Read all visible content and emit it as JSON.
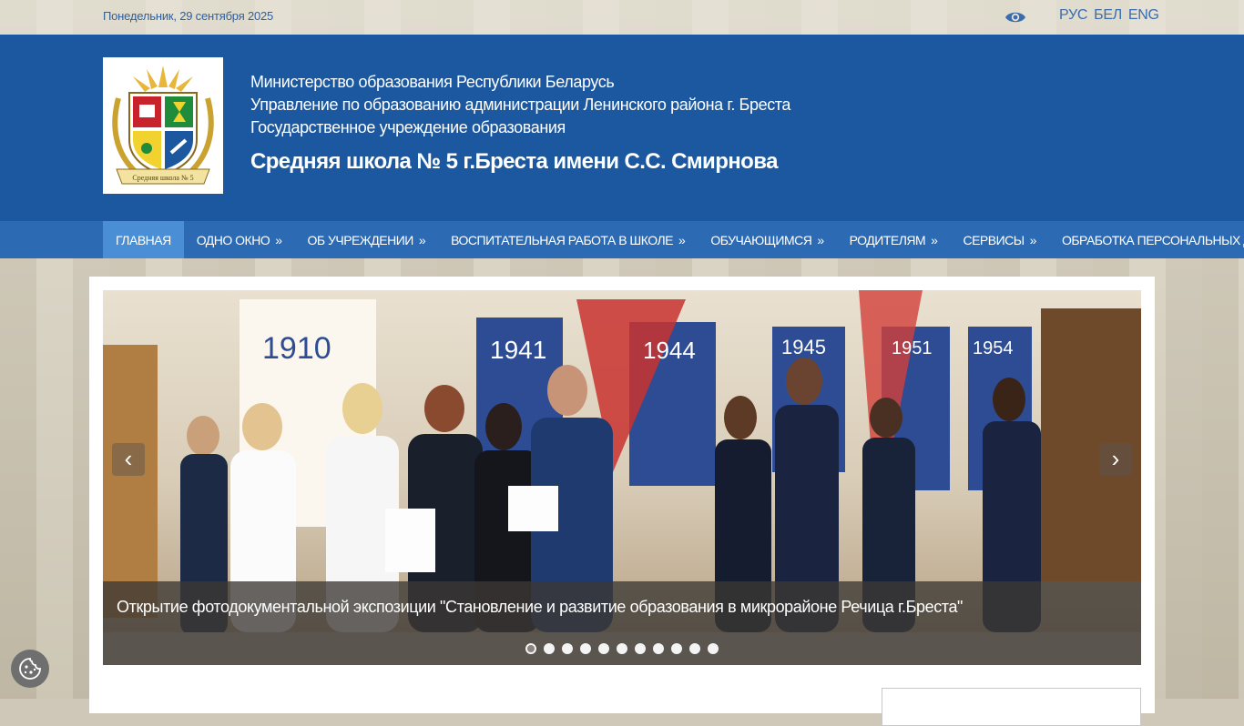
{
  "topbar": {
    "date": "Понедельник, 29 сентября 2025",
    "languages": [
      "РУС",
      "БЕЛ",
      "ENG"
    ]
  },
  "header": {
    "line1": "Министерство образования Республики Беларусь",
    "line2": "Управление по образованию администрации Ленинского района г. Бреста",
    "line3": "Государственное учреждение образования",
    "school_name": "Средняя школа № 5 г.Бреста имени С.С. Смирнова",
    "logo_text": "Средняя школа № 5"
  },
  "nav": {
    "items": [
      {
        "label": "Главная",
        "submenu": false
      },
      {
        "label": "Одно окно",
        "submenu": true
      },
      {
        "label": "Об учреждении",
        "submenu": true
      },
      {
        "label": "Воспитательная работа в школе",
        "submenu": true
      },
      {
        "label": "Обучающимся",
        "submenu": true
      },
      {
        "label": "Родителям",
        "submenu": true
      },
      {
        "label": "Сервисы",
        "submenu": true
      },
      {
        "label": "Обработка персональных данных",
        "submenu": false
      }
    ],
    "submenu_marker": "»"
  },
  "slider": {
    "caption": "Открытие фотодокументальной экспозиции \"Становление и развитие образования в микрорайоне Речица г.Бреста\"",
    "slide_count": 11,
    "active_index": 0,
    "prev_symbol": "‹",
    "next_symbol": "›",
    "photo_year_labels": [
      "1910",
      "1941",
      "1944",
      "1945",
      "1951",
      "1954"
    ]
  },
  "colors": {
    "header_blue": "#1c58a0",
    "nav_blue": "#2c6bb4",
    "nav_active": "#4a8fd6",
    "date_text": "#2f5f9e"
  }
}
